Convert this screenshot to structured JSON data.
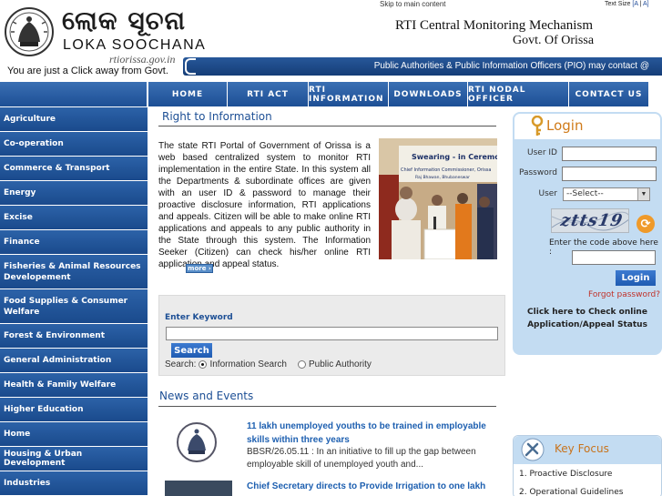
{
  "header": {
    "logo_odia": "ଲୋକ ସୂଚନା",
    "logo_english": "LOKA SOOCHANA",
    "logo_url": "rtiorissa.gov.in",
    "tagline": "You are just a Click  away from Govt.",
    "skip_link": "Skip to main content",
    "text_size_label": "Text Size",
    "text_size_a1": "A",
    "text_size_sep": "|",
    "text_size_a2": "A",
    "title_line1": "RTI Central Monitoring Mechanism",
    "title_line2": "Govt. Of Orissa",
    "ticker": "Public Authorities & Public Information Officers (PIO) may contact @"
  },
  "nav": {
    "items": [
      "HOME",
      "RTI ACT",
      "RTI INFORMATION",
      "DOWNLOADS",
      "RTI NODAL OFFICER",
      "CONTACT US"
    ]
  },
  "sidebar": {
    "items": [
      "Agriculture",
      "Co-operation",
      "Commerce & Transport",
      "Energy",
      "Excise",
      "Finance",
      "Fisheries & Animal Resources Developement",
      "Food Supplies & Consumer Welfare",
      "Forest & Environment",
      "General Administration",
      "Health & Family Welfare",
      "Higher Education",
      "Home",
      "Housing & Urban Development",
      "Industries"
    ]
  },
  "rti": {
    "title": "Right to Information",
    "text": "The state RTI Portal of Government of Orissa is a web based centralized system to monitor RTI implementation in the entire State. In this system all the Departments & subordinate offices are given with an user ID & password to manage their proactive disclosure information, RTI applications and appeals. Citizen will be able to make online RTI applications and appeals to any public authority in the State through this system. The Information Seeker (Citizen) can check his/her online RTI application and appeal status.",
    "more": "more",
    "photo_banner": "Swearing - in Ceremony",
    "photo_sub": "Chief Information Commissioner, Orissa",
    "photo_sub2": "Raj Bhawan, Bhubaneswar"
  },
  "search": {
    "label": "Enter Keyword",
    "value": "",
    "button": "Search",
    "prefix": "Search:",
    "option1": "Information Search",
    "option2": "Public Authority",
    "selected": "Information Search"
  },
  "news": {
    "title": "News and Events",
    "items": [
      {
        "headline": "11 lakh unemployed youths to be trained in employable skills within three years",
        "body": "BBSR/26.05.11 : In an initiative to fill up the gap between employable skill of unemployed youth and..."
      },
      {
        "headline": "Chief Secretary directs to Provide Irrigation to one lakh"
      }
    ]
  },
  "login": {
    "title": "Login",
    "user_id_label": "User ID",
    "password_label": "Password",
    "user_label": "User",
    "user_select": "--Select--",
    "captcha": "ztts19",
    "captcha_note": "Enter the code above here :",
    "button": "Login",
    "forgot": "Forgot password?",
    "check_status": "Click here to Check online Application/Appeal Status"
  },
  "key_focus": {
    "title": "Key Focus",
    "items": [
      "1. Proactive Disclosure",
      "2. Operational Guidelines"
    ]
  },
  "colors": {
    "nav_blue": "#1d4f95",
    "link_blue": "#1d5fb0",
    "login_bg": "#c3dcf2",
    "accent_orange": "#d07b1a",
    "forgot_red": "#c0322a"
  }
}
